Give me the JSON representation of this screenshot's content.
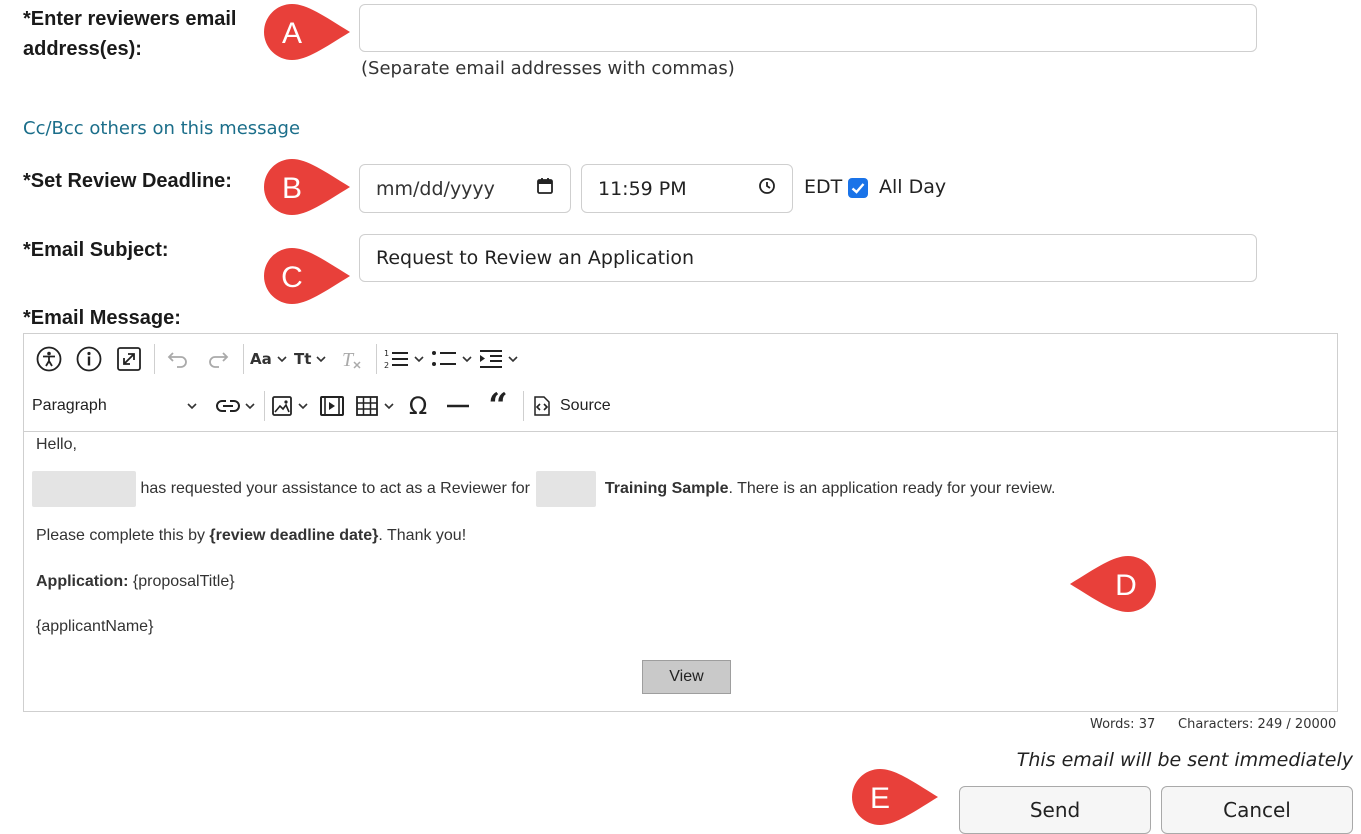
{
  "reviewers": {
    "label": "*Enter reviewers email address(es):",
    "value": "",
    "hint": "(Separate email addresses with commas)"
  },
  "cc_link": "Cc/Bcc others on this message",
  "deadline": {
    "label": "*Set Review Deadline:",
    "date_placeholder": "mm/dd/yyyy",
    "time_value": "11:59 PM",
    "timezone": "EDT",
    "all_day_label": "All Day",
    "all_day_checked": true
  },
  "subject": {
    "label": "*Email Subject:",
    "value": "Request to Review an Application"
  },
  "message": {
    "label": "*Email Message:",
    "toolbar": {
      "paragraph_label": "Paragraph",
      "source_label": "Source"
    },
    "body": {
      "greeting": "Hello,",
      "line2_mid": "has requested your assistance to act as a Reviewer for",
      "line2_bold": "Training Sample",
      "line2_end": ". There is an application ready for your review.",
      "line3_start": "Please complete this by ",
      "line3_bold": "{review deadline date}",
      "line3_end": ". Thank you!",
      "app_label": "Application:",
      "app_value": " {proposalTitle}",
      "applicant": "{applicantName}",
      "view_button": "View"
    },
    "words": "Words: 37",
    "characters": "Characters: 249 / 20000"
  },
  "notice": "This email will be sent immediately",
  "buttons": {
    "send": "Send",
    "cancel": "Cancel"
  },
  "markers": {
    "a": "A",
    "b": "B",
    "c": "C",
    "d": "D",
    "e": "E",
    "color": "#e8403a"
  }
}
